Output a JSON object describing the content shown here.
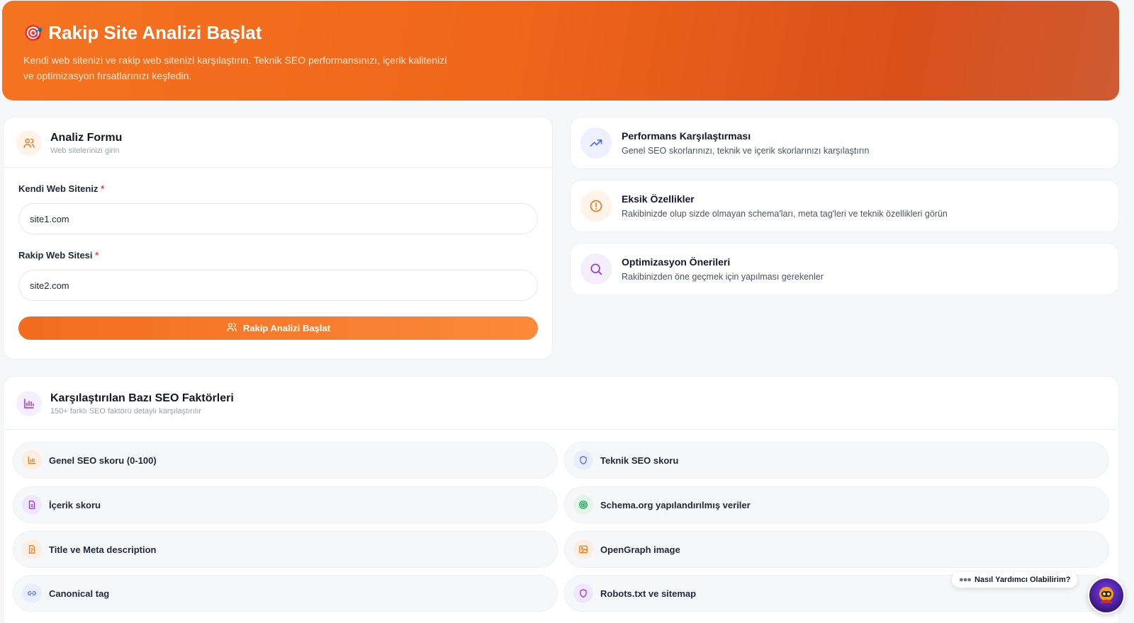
{
  "hero": {
    "title": "Rakip Site Analizi Başlat",
    "description": "Kendi web sitenizi ve rakip web sitenizi karşılaştırın. Teknik SEO performansınızı, içerik kalitenizi ve optimizasyon fırsatlarınızı keşfedin."
  },
  "form": {
    "title": "Analiz Formu",
    "subtitle": "Web sitelerinizi girin",
    "own_label": "Kendi Web Siteniz",
    "own_value": "site1.com",
    "rival_label": "Rakip Web Sitesi",
    "rival_value": "site2.com",
    "required_mark": "*",
    "submit_label": "Rakip Analizi Başlat"
  },
  "features": [
    {
      "title": "Performans Karşılaştırması",
      "desc": "Genel SEO skorlarınızı, teknik ve içerik skorlarınızı karşılaştırın",
      "icon": "trending-up-icon",
      "color": "#4f6bed"
    },
    {
      "title": "Eksik Özellikler",
      "desc": "Rakibinizde olup sizde olmayan schema'ları, meta tag'leri ve teknik özellikleri görün",
      "icon": "alert-circle-icon",
      "color": "#f07a1a"
    },
    {
      "title": "Optimizasyon Önerileri",
      "desc": "Rakibinizden öne geçmek için yapılması gerekenler",
      "icon": "search-icon",
      "color": "#9333ea"
    }
  ],
  "factors": {
    "title": "Karşılaştırılan Bazı SEO Faktörleri",
    "subtitle": "150+ farklı SEO faktörü detaylı karşılaştırılır",
    "items": [
      {
        "label": "Genel SEO skoru (0-100)",
        "icon": "bar-chart-icon",
        "color": "#f07a1a"
      },
      {
        "label": "Teknik SEO skoru",
        "icon": "shield-icon",
        "color": "#4f6bed"
      },
      {
        "label": "İçerik skoru",
        "icon": "document-icon",
        "color": "#9333ea"
      },
      {
        "label": "Schema.org yapılandırılmış veriler",
        "icon": "target-icon",
        "color": "#16a34a"
      },
      {
        "label": "Title ve Meta description",
        "icon": "file-text-icon",
        "color": "#f07a1a"
      },
      {
        "label": "OpenGraph image",
        "icon": "image-icon",
        "color": "#f07a1a"
      },
      {
        "label": "Canonical tag",
        "icon": "link-icon",
        "color": "#4f6bed"
      },
      {
        "label": "Robots.txt ve sitemap",
        "icon": "shield-icon",
        "color": "#9333ea"
      }
    ]
  },
  "chat": {
    "prompt": "Nasıl Yardımcı Olabilirim?"
  }
}
